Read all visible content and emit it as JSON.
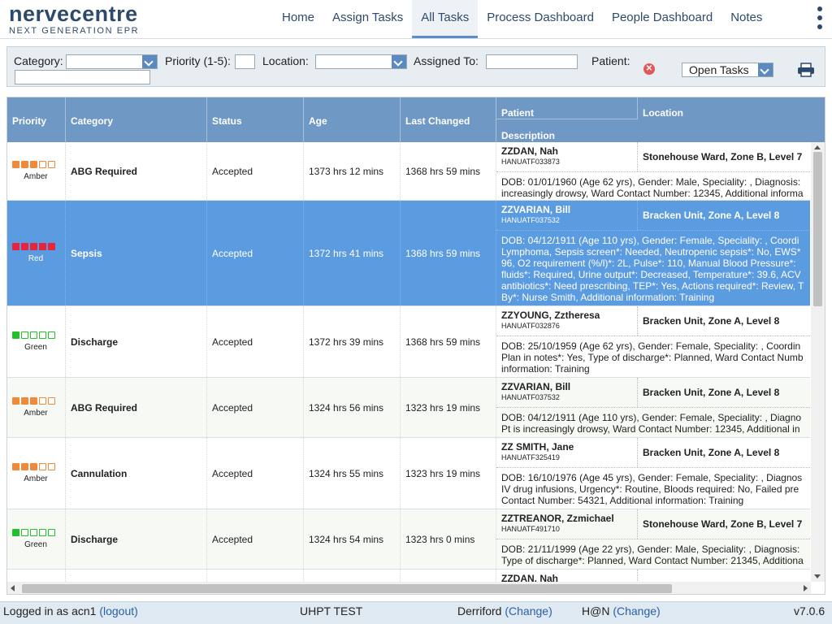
{
  "app": {
    "logo_main": "nervecentre",
    "logo_sub": "NEXT GENERATION EPR"
  },
  "nav": {
    "items": [
      {
        "label": "Home"
      },
      {
        "label": "Assign Tasks"
      },
      {
        "label": "All Tasks",
        "active": true
      },
      {
        "label": "Process Dashboard"
      },
      {
        "label": "People Dashboard"
      },
      {
        "label": "Notes"
      }
    ]
  },
  "filters": {
    "category_label": "Category:",
    "category_value": "",
    "priority_label": "Priority (1-5):",
    "priority_value": "",
    "location_label": "Location:",
    "location_value": "",
    "assigned_label": "Assigned To:",
    "assigned_value": "",
    "patient_label": "Patient:",
    "patient_value": "",
    "task_filter": "Open Tasks"
  },
  "table": {
    "headers": {
      "priority": "Priority",
      "category": "Category",
      "status": "Status",
      "age": "Age",
      "last_changed": "Last Changed",
      "patient": "Patient",
      "location": "Location",
      "description": "Description"
    },
    "rows": [
      {
        "priority_label": "Amber",
        "priority_level": 3,
        "category": "ABG Required",
        "status": "Accepted",
        "age": "1373 hrs 12 mins",
        "last_changed": "1368 hrs 59 mins",
        "patient_name": "ZZDAN, Nah",
        "patient_id": "HANUATF033873",
        "location": "Stonehouse Ward, Zone B, Level 7",
        "description": [
          "DOB: 01/01/1960 (Age 62 yrs), Gender: Male, Speciality: , Diagnosis:",
          "increasingly drowsy, Ward Contact Number: 12345, Additional informa"
        ]
      },
      {
        "priority_label": "Red",
        "priority_level": 5,
        "category": "Sepsis",
        "status": "Accepted",
        "age": "1372 hrs 41 mins",
        "last_changed": "1368 hrs 59 mins",
        "patient_name": "ZZVARIAN, Bill",
        "patient_id": "HANUATF037532",
        "location": "Bracken Unit, Zone A, Level 8",
        "selected": true,
        "description": [
          "DOB: 04/12/1911 (Age 110 yrs), Gender: Female, Speciality: , Coordi",
          "Lymphoma, Sepsis screen*: Needed, Neutropenic sepsis*: No, EWS*",
          "96, O2 requirement (%/l)*: 2L, Pulse*: 110, Manual Blood Pressure*:",
          "fluids*: Required, Urine output*: Decreased, Temperature*: 39.6, ACV",
          "antibiotics*: Need prescribing, TEP*: Yes, Actions required*: Review, T",
          "By*: Nurse Smith, Additional information: Training"
        ]
      },
      {
        "priority_label": "Green",
        "priority_level": 1,
        "category": "Discharge",
        "status": "Accepted",
        "age": "1372 hrs 39 mins",
        "last_changed": "1368 hrs 59 mins",
        "patient_name": "ZZYOUNG, Zztheresa",
        "patient_id": "HANUATF032876",
        "location": "Bracken Unit, Zone A, Level 8",
        "description": [
          "DOB: 25/10/1959 (Age 62 yrs), Gender: Female, Speciality: , Coordin",
          "Plan in notes*: Yes, Type of discharge*: Planned, Ward Contact Numb",
          "information: Training"
        ]
      },
      {
        "priority_label": "Amber",
        "priority_level": 3,
        "category": "ABG Required",
        "status": "Accepted",
        "age": "1324 hrs 56 mins",
        "last_changed": "1323 hrs 19 mins",
        "patient_name": "ZZVARIAN, Bill",
        "patient_id": "HANUATF037532",
        "location": "Bracken Unit, Zone A, Level 8",
        "description": [
          "DOB: 04/12/1911 (Age 110 yrs), Gender: Female, Speciality: , Diagno",
          "Pt is increasingly drowsy, Ward Contact Number: 12345, Additional in"
        ]
      },
      {
        "priority_label": "Amber",
        "priority_level": 3,
        "category": "Cannulation",
        "status": "Accepted",
        "age": "1324 hrs 55 mins",
        "last_changed": "1323 hrs 19 mins",
        "patient_name": "ZZ SMITH, Jane",
        "patient_id": "HANUATF325419",
        "location": "Bracken Unit, Zone A, Level 8",
        "description": [
          "DOB: 16/10/1976 (Age 45 yrs), Gender: Female, Speciality: , Diagnos",
          "IV drug infusions, Urgency*: Routine, Bloods required: No, Failed pre",
          "Contact Number: 54321, Additional information: Training"
        ]
      },
      {
        "priority_label": "Green",
        "priority_level": 1,
        "category": "Discharge",
        "status": "Accepted",
        "age": "1324 hrs 54 mins",
        "last_changed": "1323 hrs 0 mins",
        "patient_name": "ZZTREANOR, Zzmichael",
        "patient_id": "HANUATF491710",
        "location": "Stonehouse Ward, Zone B, Level 7",
        "description": [
          "DOB: 21/11/1999 (Age 22 yrs), Gender: Male, Speciality: , Diagnosis:",
          "Type of discharge*: Planned, Ward Contact Number: 21345, Additiona"
        ]
      },
      {
        "priority_label": "",
        "priority_level": 0,
        "category": "",
        "status": "",
        "age": "",
        "last_changed": "",
        "patient_name": "ZZDAN, Nah",
        "patient_id": "",
        "location": "",
        "description": []
      }
    ]
  },
  "footer": {
    "logged_in_prefix": "Logged in as acn1",
    "logout": "(logout)",
    "trust": "UHPT TEST",
    "site": "Derriford",
    "site_change": "(Change)",
    "mode": "H@N",
    "mode_change": "(Change)",
    "version": "v7.0.6"
  },
  "colors": {
    "amber": "#f08a3a",
    "red": "#e8243c",
    "green": "#22c12a",
    "header_blue": "#6f98c4",
    "selected_row": "#5b9be0"
  }
}
